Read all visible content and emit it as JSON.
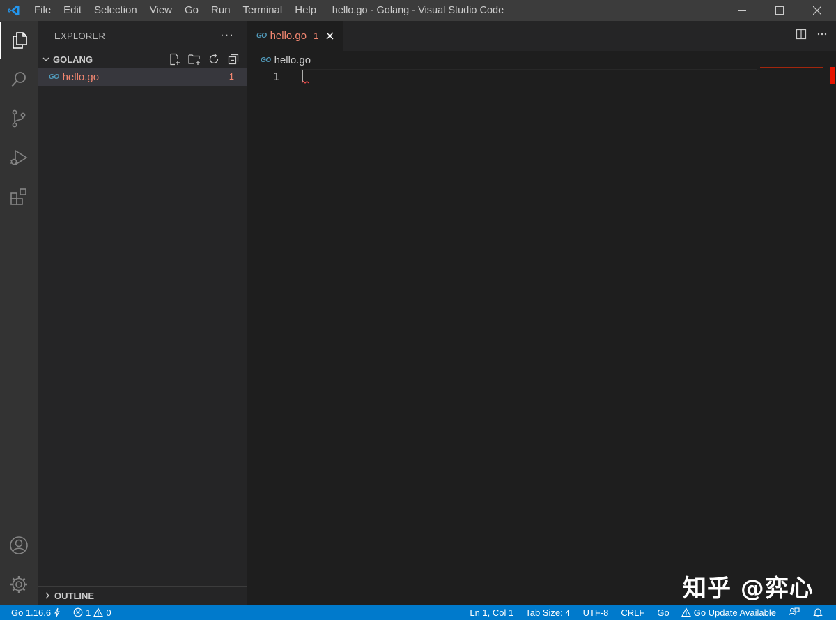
{
  "titlebar": {
    "menu": [
      "File",
      "Edit",
      "Selection",
      "View",
      "Go",
      "Run",
      "Terminal",
      "Help"
    ],
    "window_title": "hello.go - Golang - Visual Studio Code"
  },
  "sidebar": {
    "header": "EXPLORER",
    "more_label": "···",
    "folder": "GOLANG",
    "files": [
      {
        "name": "hello.go",
        "problems": "1",
        "icon": "go-file-icon"
      }
    ],
    "outline_label": "OUTLINE"
  },
  "editor": {
    "tab": {
      "label": "hello.go",
      "problems": "1"
    },
    "breadcrumb": "hello.go",
    "line_numbers": [
      "1"
    ],
    "go_badge": "GO"
  },
  "statusbar": {
    "go_version": "Go 1.16.6",
    "errors": "1",
    "warnings": "0",
    "position": "Ln 1, Col 1",
    "tab_size": "Tab Size: 4",
    "encoding": "UTF-8",
    "eol": "CRLF",
    "language": "Go",
    "update": "Go Update Available"
  },
  "watermark": "知乎 @弈心",
  "colors": {
    "accent": "#007acc",
    "error": "#f48771",
    "go_blue": "#519aba"
  }
}
